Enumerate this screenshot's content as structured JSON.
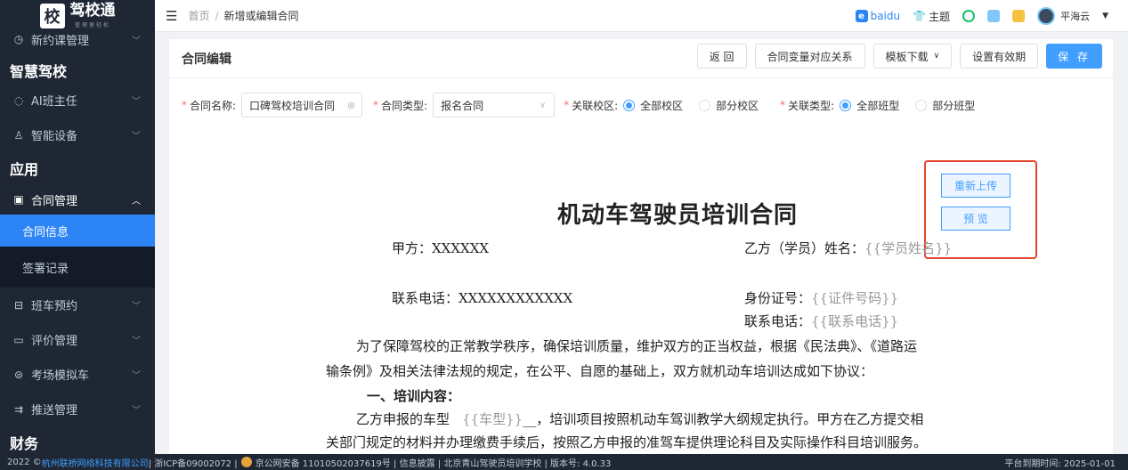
{
  "sidebar": {
    "logo_char": "校",
    "logo_text": "驾校通",
    "logo_sub": "管理更轻松",
    "items": [
      {
        "label": "新约课管理",
        "icon": "clock-icon"
      },
      {
        "section": "智慧驾校"
      },
      {
        "label": "AI班主任",
        "icon": "ai-icon"
      },
      {
        "label": "智能设备",
        "icon": "device-icon"
      },
      {
        "section": "应用"
      },
      {
        "label": "合同管理",
        "icon": "contract-icon"
      },
      {
        "sub": "合同信息"
      },
      {
        "sub": "签署记录"
      },
      {
        "label": "班车预约",
        "icon": "bus-icon"
      },
      {
        "label": "评价管理",
        "icon": "comment-icon"
      },
      {
        "label": "考场模拟车",
        "icon": "car-icon"
      },
      {
        "label": "推送管理",
        "icon": "push-icon"
      },
      {
        "section": "财务"
      }
    ]
  },
  "topbar": {
    "home": "首页",
    "current": "新增或编辑合同",
    "baidu": "baidu",
    "theme": "主题",
    "user": "平海云"
  },
  "main": {
    "title": "合同编辑",
    "buttons": {
      "back": "返 回",
      "vars": "合同变量对应关系",
      "template": "模板下载",
      "validity": "设置有效期",
      "save": "保 存"
    },
    "form": {
      "name_label": "合同名称:",
      "name_value": "口碑驾校培训合同",
      "type_label": "合同类型:",
      "type_value": "报名合同",
      "campus_label": "关联校区:",
      "campus_all": "全部校区",
      "campus_part": "部分校区",
      "class_label": "关联类型:",
      "class_all": "全部班型",
      "class_part": "部分班型"
    },
    "upload": {
      "reupload": "重新上传",
      "preview": "预 览"
    },
    "document": {
      "title": "机动车驾驶员培训合同",
      "party_a": "甲方：XXXXXX",
      "party_b_label": "乙方（学员）姓名：",
      "party_b_var": "{{学员姓名}}",
      "phone_a": "联系电话：XXXXXXXXXXXX",
      "id_label": "身份证号：",
      "id_var": "{{证件号码}}",
      "phone_b_label": "联系电话：",
      "phone_b_var": "{{联系电话}}",
      "para1": "为了保障驾校的正常教学秩序，确保培训质量，维护双方的正当权益，根据《民法典》、《道路运",
      "para2": "输条例》及相关法律法规的规定，在公平、自愿的基础上，双方就机动车培训达成如下协议：",
      "section1": "一、培训内容：",
      "para3_a": "乙方申报的车型",
      "para3_var": "{{车型}}",
      "para3_b": "__，培训项目按照机动车驾训教学大纲规定执行。甲方在乙方提交相",
      "para4": "关部门规定的材料并办理缴费手续后，按照乙方申报的准驾车提供理论科目及实际操作科目培训服务。"
    }
  },
  "footer": {
    "prefix": "2022 ©",
    "company": "杭州联桥网络科技有限公司",
    "icp": " | 浙ICP备09002072 | ",
    "police": "京公网安备 11010502037619号 | 信息披露 | 北京青山驾驶员培训学校 | 版本号: 4.0.33",
    "expire": "平台到期时间: 2025-01-01"
  }
}
